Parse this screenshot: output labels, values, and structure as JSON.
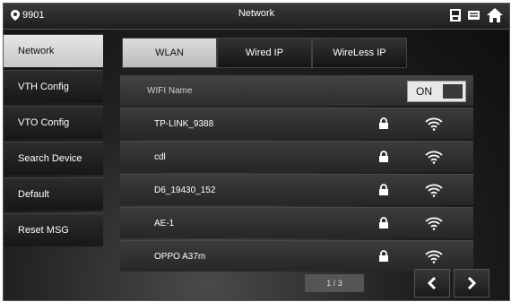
{
  "header": {
    "room": "9901",
    "title": "Network"
  },
  "sidebar": {
    "items": [
      {
        "label": "Network",
        "active": true
      },
      {
        "label": "VTH Config"
      },
      {
        "label": "VTO Config"
      },
      {
        "label": "Search Device"
      },
      {
        "label": "Default"
      },
      {
        "label": "Reset MSG"
      }
    ]
  },
  "tabs": [
    {
      "label": "WLAN",
      "active": true
    },
    {
      "label": "Wired IP"
    },
    {
      "label": "WireLess IP"
    }
  ],
  "wifi": {
    "header_label": "WIFI Name",
    "toggle_label": "ON",
    "networks": [
      {
        "name": "TP-LINK_9388",
        "locked": true
      },
      {
        "name": "cdl",
        "locked": true
      },
      {
        "name": "D6_19430_152",
        "locked": true
      },
      {
        "name": "AE-1",
        "locked": true
      },
      {
        "name": "OPPO A37m",
        "locked": true
      }
    ]
  },
  "pagination": {
    "label": "1 / 3"
  },
  "icons": {
    "location": "location-pin-icon",
    "home": "home-icon"
  }
}
